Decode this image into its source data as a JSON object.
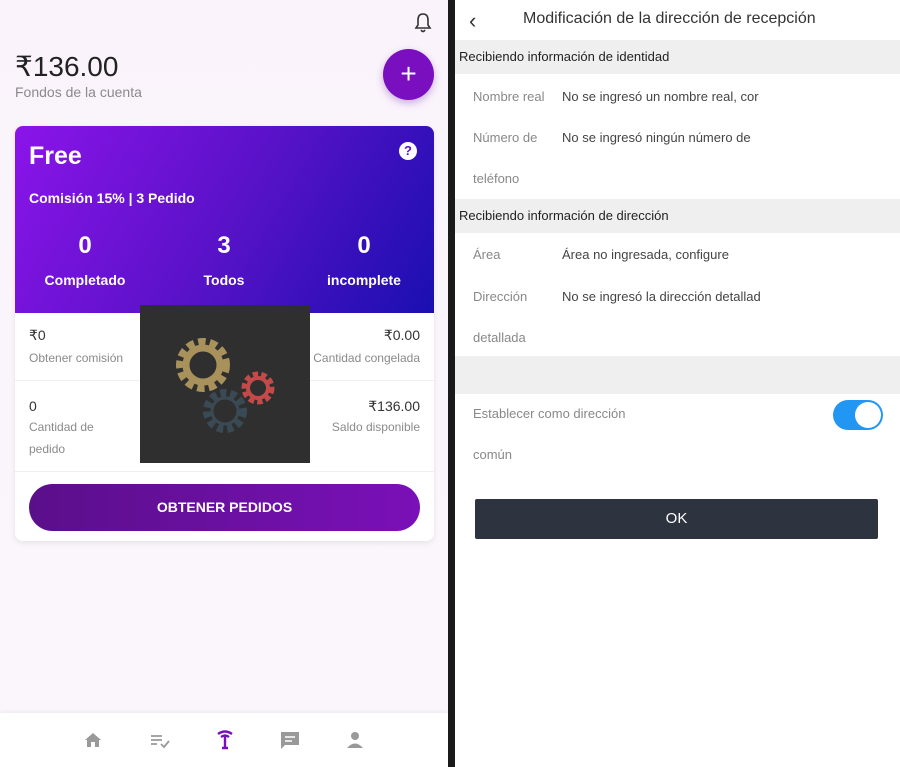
{
  "dashboard": {
    "balance": "₹136.00",
    "balance_label": "Fondos de la cuenta",
    "plus_label": "+",
    "plan": {
      "name": "Free",
      "help": "?",
      "commission": "Comisión 15% | 3 Pedido",
      "stats": [
        {
          "value": "0",
          "label": "Completado"
        },
        {
          "value": "3",
          "label": "Todos"
        },
        {
          "value": "0",
          "label": "incomplete"
        }
      ]
    },
    "details": {
      "commission_value": "₹0",
      "commission_label": "Obtener comisión",
      "frozen_value": "₹0.00",
      "frozen_label": "Cantidad congelada",
      "orders_value": "0",
      "orders_label_1": "Cantidad de",
      "orders_label_2": "pedido",
      "available_value": "₹136.00",
      "available_label": "Saldo disponible"
    },
    "get_orders_button": "OBTENER PEDIDOS",
    "tabbar": [
      "home-icon",
      "list-check-icon",
      "grab-order-icon",
      "message-icon",
      "person-icon"
    ],
    "accent_color": "#7a0fc0"
  },
  "address_form": {
    "back_icon": "‹",
    "title": "Modificación de la dirección de recepción",
    "identity_section": "Recibiendo información de identidad",
    "name_label": "Nombre real",
    "name_value": "No se ingresó un nombre real, cor",
    "phone_label_1": "Número de",
    "phone_label_2": "teléfono",
    "phone_value": "No se ingresó ningún número de",
    "address_section": "Recibiendo información de dirección",
    "area_label": "Área",
    "area_value": "Área no ingresada, configure",
    "detail_label_1": "Dirección",
    "detail_label_2": "detallada",
    "detail_value": "No se ingresó la dirección detallad",
    "default_label_1": "Establecer como dirección",
    "default_label_2": "común",
    "default_on": true,
    "ok_button": "OK",
    "toggle_color": "#2196f3"
  }
}
